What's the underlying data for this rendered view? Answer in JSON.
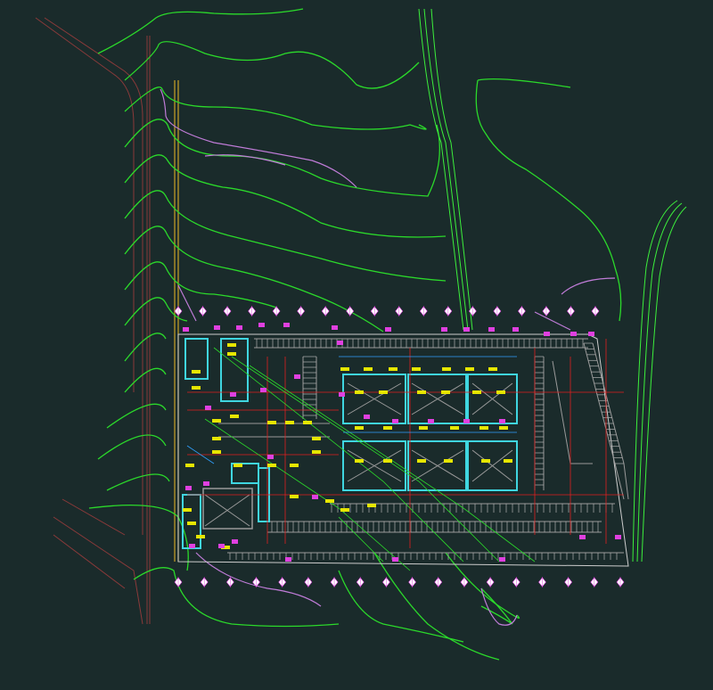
{
  "drawing": {
    "background": "#1a2b2b",
    "colors": {
      "contour": "#2bd92b",
      "contour_alt": "#3cf03c",
      "boundary": "#c07cd8",
      "road": "#8b3a3a",
      "easement": "#c9a227",
      "parking": "#9a9a9a",
      "building": "#3fd6e0",
      "utility": "#e02020",
      "grid_marker": "#e040e0",
      "tag": "#e6e600",
      "water": "#2fa0ff"
    },
    "grid_marker_count_top": 18,
    "grid_marker_count_bottom": 18,
    "site_note": ""
  }
}
